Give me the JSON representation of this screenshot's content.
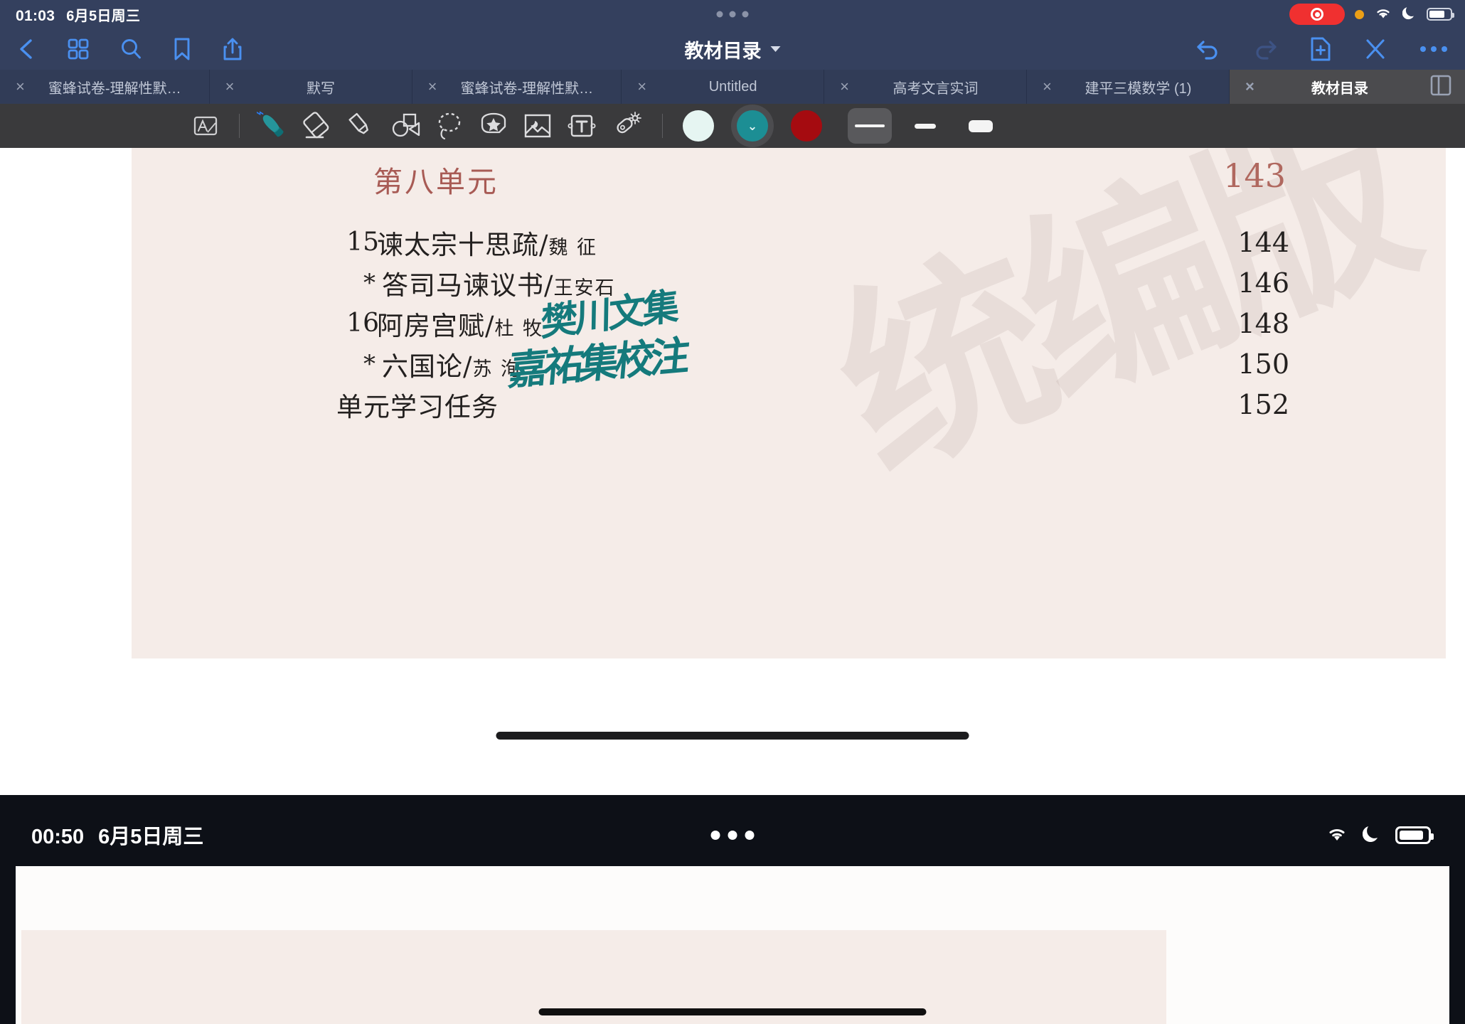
{
  "top_window": {
    "status_bar": {
      "time": "01:03",
      "date": "6月5日周三",
      "icons": [
        "screen-recording-indicator",
        "microphone-active-dot",
        "wifi-icon",
        "do-not-disturb-moon-icon",
        "battery-icon"
      ]
    },
    "nav_bar": {
      "title": "教材目录",
      "left_icons": [
        "back-chevron-icon",
        "thumbnails-grid-icon",
        "search-icon",
        "bookmark-icon",
        "share-icon"
      ],
      "right_icons": [
        "undo-icon",
        "redo-icon",
        "add-page-icon",
        "close-pen-icon",
        "more-options-icon"
      ]
    },
    "tabs": [
      {
        "label": "蜜蜂试卷-理解性默…",
        "active": false
      },
      {
        "label": "默写",
        "active": false
      },
      {
        "label": "蜜蜂试卷-理解性默…",
        "active": false
      },
      {
        "label": "Untitled",
        "active": false
      },
      {
        "label": "高考文言实词",
        "active": false
      },
      {
        "label": "建平三模数学 (1)",
        "active": false
      },
      {
        "label": "教材目录",
        "active": true
      }
    ],
    "tab_close_label": "×",
    "toolbar": {
      "tools": [
        {
          "name": "convert-handwriting-icon",
          "active": false
        },
        {
          "name": "pen-icon",
          "active": true,
          "bluetooth": true
        },
        {
          "name": "eraser-icon",
          "active": false
        },
        {
          "name": "highlighter-icon",
          "active": false
        },
        {
          "name": "shapes-icon",
          "active": false
        },
        {
          "name": "lasso-select-icon",
          "active": false
        },
        {
          "name": "sticker-star-icon",
          "active": false
        },
        {
          "name": "image-icon",
          "active": false
        },
        {
          "name": "text-box-icon",
          "active": false
        },
        {
          "name": "laser-pointer-icon",
          "active": false
        }
      ],
      "colors": [
        {
          "name": "color-swatch-white",
          "hex": "#e6f5f2",
          "selected": false
        },
        {
          "name": "color-swatch-teal",
          "hex": "#1c8e94",
          "selected": true
        },
        {
          "name": "color-swatch-dark-red",
          "hex": "#a50b10",
          "selected": false
        }
      ],
      "widths": [
        {
          "name": "stroke-width-thin",
          "selected": true
        },
        {
          "name": "stroke-width-medium",
          "selected": false
        },
        {
          "name": "stroke-width-thick",
          "selected": false
        }
      ]
    },
    "document": {
      "watermark": "统编版",
      "unit_heading": "第八单元",
      "unit_page": "143",
      "entries": [
        {
          "num": "15",
          "star": "",
          "title": "谏太宗十思疏",
          "sep": "/",
          "author": "魏 征",
          "page": "144"
        },
        {
          "num": "",
          "star": "*",
          "title": "答司马谏议书",
          "sep": "/",
          "author": "王安石",
          "page": "146"
        },
        {
          "num": "16",
          "star": "",
          "title": "阿房宫赋",
          "sep": "/",
          "author": "杜 牧",
          "page": "148"
        },
        {
          "num": "",
          "star": "*",
          "title": "六国论",
          "sep": "/",
          "author": "苏 洵",
          "page": "150"
        },
        {
          "num": "",
          "star": "",
          "title": "单元学习任务",
          "sep": "",
          "author": "",
          "page": "152"
        }
      ],
      "handwriting": [
        {
          "name": "handwritten-note-fanchuan",
          "text": "樊川文集",
          "color": "#157a7c"
        },
        {
          "name": "handwritten-note-jiayou",
          "text": "嘉祐集校注",
          "color": "#157a7c"
        }
      ]
    }
  },
  "bottom_window": {
    "status_bar": {
      "time": "00:50",
      "date": "6月5日周三",
      "icons": [
        "wifi-icon",
        "do-not-disturb-moon-icon",
        "battery-icon"
      ]
    }
  }
}
